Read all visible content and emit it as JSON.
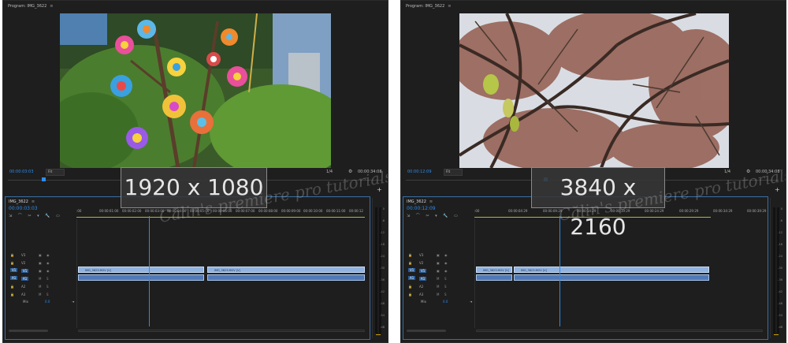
{
  "left": {
    "monitor_tab": "Program: IMG_3622",
    "timecode": "00:00:03:03",
    "fit": "Fit",
    "quality": "1/4",
    "duration": "00:00:34:08",
    "resolution": "1920 x 1080",
    "sequence_tab": "IMG_3622",
    "sequence_timecode": "00:00:03:03",
    "ruler": [
      ":00",
      "00:00:01:00",
      "00:00:02:00",
      "00:00:03:00",
      "00:00:04:00",
      "00:00:05:00",
      "00:00:06:00",
      "00:00:07:00",
      "00:00:08:00",
      "00:00:09:00",
      "00:00:10:00",
      "00:00:11:00",
      "00:00:12"
    ],
    "clips": [
      "IMG_3623.MOV [V]",
      "IMG_3623.MOV [V]"
    ],
    "mix": "Mix",
    "mix_value": "0.0",
    "scrub_fraction": 0.09
  },
  "right": {
    "monitor_tab": "Program: IMG_3622",
    "timecode": "00:00:12:09",
    "fit": "Fit",
    "quality": "1/4",
    "duration": "00:00:34:08",
    "resolution": "3840 x 2160",
    "sequence_tab": "IMG_3622",
    "sequence_timecode": "00:00:12:09",
    "ruler": [
      ":00",
      "00:00:04:29",
      "00:00:09:29",
      "00:00:14:29",
      "00:00:19:29",
      "00:00:24:29",
      "00:00:29:29",
      "00:00:34:29",
      "00:00:39:29"
    ],
    "clips": [
      "IMG_3623.MOV [V]",
      "IMG_3623.MOV [V]"
    ],
    "mix": "Mix",
    "mix_value": "0.0",
    "scrub_fraction": 0.37
  },
  "tracks": [
    "V3",
    "V2",
    "V1",
    "A1",
    "A2",
    "A3"
  ],
  "track_flags": [
    "M",
    "S"
  ],
  "tools": "⇲ ⌒ ✂ ▾ 🔧 ▭",
  "meter_scale": [
    "0",
    "-6",
    "-12",
    "-18",
    "-24",
    "-30",
    "-36",
    "-42",
    "-48",
    "-54",
    "dB"
  ],
  "watermark": "Călin's premiere pro tutorials",
  "colors": {
    "accent": "#2d8ceb",
    "video_clip": "#8fb2e0",
    "audio_clip": "#4f79b8",
    "panel_bg": "#1e1e1e"
  },
  "icons": [
    "wrench-icon",
    "plus-icon",
    "close-icon",
    "lock-icon",
    "eye-icon",
    "speaker-icon"
  ]
}
